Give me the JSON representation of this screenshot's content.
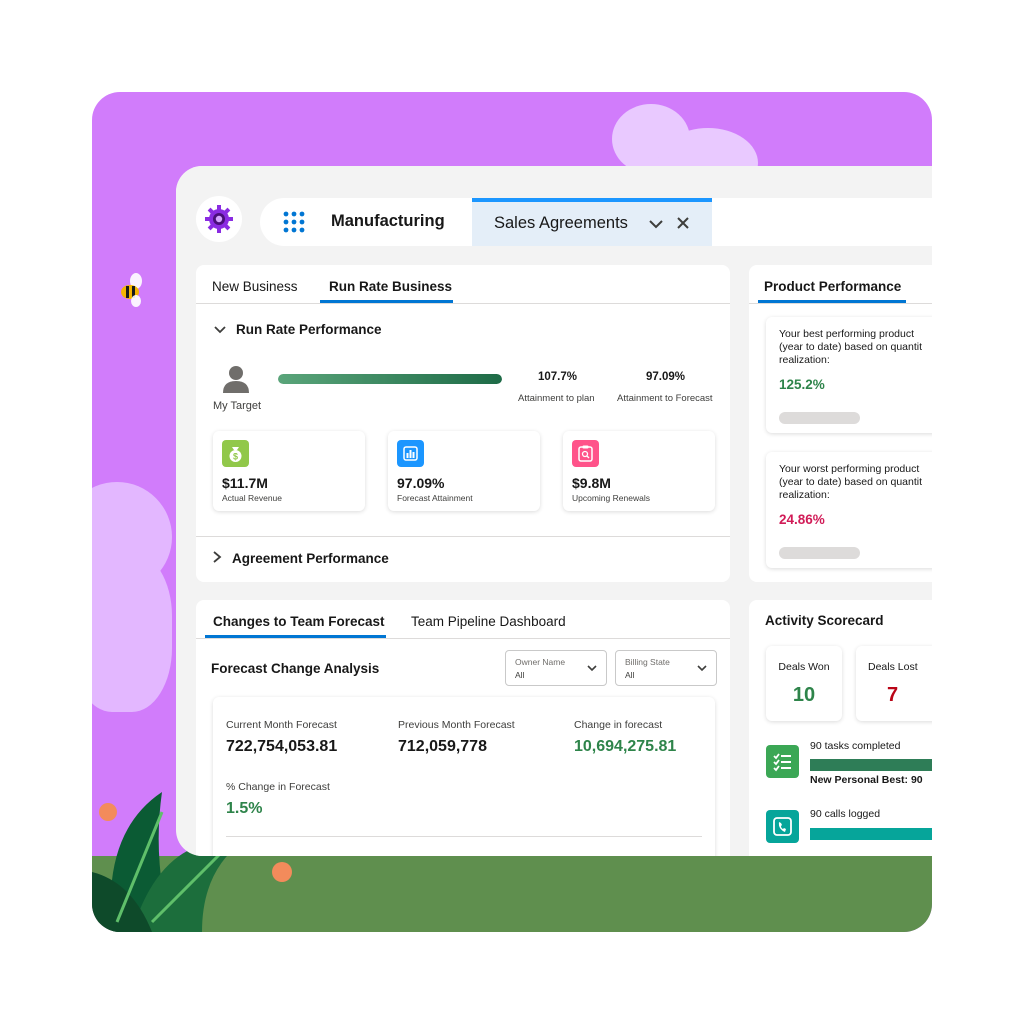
{
  "app": {
    "name": "Manufacturing",
    "tab": {
      "label": "Sales Agreements"
    }
  },
  "run_rate_card": {
    "tabs": [
      "New Business",
      "Run Rate Business"
    ],
    "section_title": "Run Rate Performance",
    "target_label": "My Target",
    "progress": 1.0,
    "attainment_plan": {
      "value": "107.7%",
      "label": "Attainment to plan"
    },
    "attainment_forecast": {
      "value": "97.09%",
      "label": "Attainment to Forecast"
    },
    "kpis": [
      {
        "value": "$11.7M",
        "label": "Actual Revenue",
        "color": "#91c84a",
        "icon": "money-bag-icon"
      },
      {
        "value": "97.09%",
        "label": "Forecast Attainment",
        "color": "#1b96ff",
        "icon": "bar-chart-icon"
      },
      {
        "value": "$9.8M",
        "label": "Upcoming Renewals",
        "color": "#ff538a",
        "icon": "clipboard-search-icon"
      }
    ],
    "collapsed_section": "Agreement Performance"
  },
  "product_card": {
    "tab": "Product Performance",
    "best": {
      "text": "Your best performing product (year to date) based on quantit realization:",
      "value": "125.2%"
    },
    "worst": {
      "text": "Your worst performing product (year to date) based on quantit realization:",
      "value": "24.86%"
    }
  },
  "forecast_card": {
    "tabs": [
      "Changes to Team Forecast",
      "Team Pipeline Dashboard"
    ],
    "title": "Forecast Change Analysis",
    "filters": [
      {
        "label": "Owner Name",
        "value": "All"
      },
      {
        "label": "Billing State",
        "value": "All"
      }
    ],
    "metrics": [
      {
        "label": "Current Month Forecast",
        "value": "722,754,053.81"
      },
      {
        "label": "Previous Month Forecast",
        "value": "712,059,778"
      },
      {
        "label": "Change in forecast",
        "value": "10,694,275.81"
      },
      {
        "label": "% Change in Forecast",
        "value": "1.5%"
      }
    ]
  },
  "activity_card": {
    "title": "Activity Scorecard",
    "deals_won": {
      "label": "Deals Won",
      "value": "10"
    },
    "deals_lost": {
      "label": "Deals Lost",
      "value": "7"
    },
    "tasks": {
      "label": "90 tasks completed",
      "note": "New Personal Best: 90",
      "color": "#3ba755"
    },
    "calls": {
      "label": "90 calls logged",
      "color": "#06a59a"
    }
  }
}
